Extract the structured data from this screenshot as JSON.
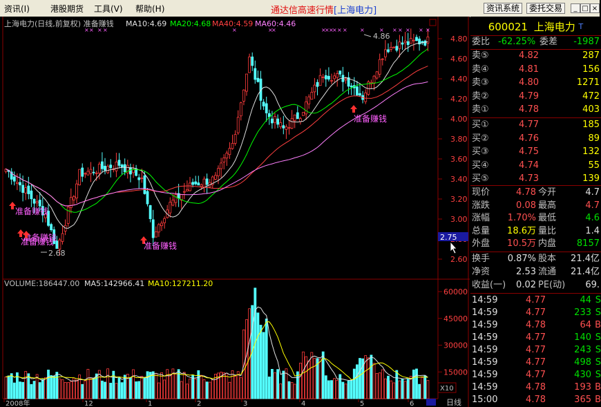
{
  "menu": [
    "资讯(I)",
    "港股期货",
    "工具(V)",
    "帮助(H)"
  ],
  "app_title": "通达信高速行情",
  "app_title_stock": "[上海电力]",
  "toolbar": {
    "info_system": "资讯系统",
    "trade": "委托交易"
  },
  "window_controls": [
    "_",
    "□",
    "×"
  ],
  "chart": {
    "header_title": "上海电力(日线,前复权) 准备赚钱",
    "ma_labels": [
      {
        "text": "MA10:4.69",
        "color": "#e0e0e0"
      },
      {
        "text": "MA20:4.68",
        "color": "#00ff00"
      },
      {
        "text": "MA40:4.59",
        "color": "#ff4040"
      },
      {
        "text": "MA60:4.46",
        "color": "#ff80ff"
      }
    ],
    "price_ticks": [
      "4.80",
      "4.60",
      "4.40",
      "4.20",
      "4.00",
      "3.80",
      "3.60",
      "3.40",
      "3.20",
      "3.00",
      "2.80",
      "2.60"
    ],
    "price_marker": "2.75",
    "high_label": "4.86",
    "low_label": "2.68",
    "signal_text": "准备赚钱",
    "volume_header": "VOLUME:186447.00",
    "vol_ma5": "MA5:142966.41",
    "vol_ma10": "MA10:127211.20",
    "volume_ticks": [
      "60000",
      "45000",
      "30000",
      "15000"
    ],
    "vol_unit": "X10",
    "date_labels": [
      "2008年",
      "12",
      "1",
      "2",
      "3",
      "4",
      "5",
      "6"
    ],
    "period": "日线"
  },
  "colors": {
    "up": "#ff3c3c",
    "down": "#54ffff",
    "ma10": "#e0e0e0",
    "ma20": "#00ff00",
    "ma40": "#ff4040",
    "ma60": "#ff80ff",
    "grid": "#8b0000"
  },
  "quote": {
    "code": "600021",
    "name": "上海电力",
    "ratio_label": "委比",
    "ratio": "-62.25%",
    "diff_label": "委差",
    "diff": "-1987",
    "asks": [
      {
        "label": "卖⑤",
        "price": "4.82",
        "vol": "287"
      },
      {
        "label": "卖④",
        "price": "4.81",
        "vol": "156"
      },
      {
        "label": "卖③",
        "price": "4.80",
        "vol": "1271"
      },
      {
        "label": "卖②",
        "price": "4.79",
        "vol": "472"
      },
      {
        "label": "卖①",
        "price": "4.78",
        "vol": "403"
      }
    ],
    "bids": [
      {
        "label": "买①",
        "price": "4.77",
        "vol": "185"
      },
      {
        "label": "买②",
        "price": "4.76",
        "vol": "89"
      },
      {
        "label": "买③",
        "price": "4.75",
        "vol": "132"
      },
      {
        "label": "买④",
        "price": "4.74",
        "vol": "55"
      },
      {
        "label": "买⑤",
        "price": "4.73",
        "vol": "139"
      }
    ],
    "stats": [
      {
        "l1": "现价",
        "v1": "4.78",
        "l2": "今开",
        "v2": "4.7"
      },
      {
        "l1": "涨跌",
        "v1": "0.08",
        "l2": "最高",
        "v2": "4.7"
      },
      {
        "l1": "涨幅",
        "v1": "1.70%",
        "l2": "最低",
        "v2": "4.6"
      },
      {
        "l1": "总量",
        "v1": "18.6万",
        "l2": "量比",
        "v2": "1.4"
      },
      {
        "l1": "外盘",
        "v1": "10.5万",
        "l2": "内盘",
        "v2": "8157"
      }
    ],
    "stats2": [
      {
        "l1": "换手",
        "v1": "0.87%",
        "l2": "股本",
        "v2": "21.4亿"
      },
      {
        "l1": "净资",
        "v1": "2.53",
        "l2": "流通",
        "v2": "21.4亿"
      },
      {
        "l1": "收益(一)",
        "v1": "0.02",
        "l2": "PE(动)",
        "v2": "69."
      }
    ],
    "ticks": [
      {
        "time": "14:59",
        "price": "4.77",
        "vol": "44",
        "dir": "S"
      },
      {
        "time": "14:59",
        "price": "4.77",
        "vol": "233",
        "dir": "S"
      },
      {
        "time": "14:59",
        "price": "4.78",
        "vol": "64",
        "dir": "B"
      },
      {
        "time": "14:59",
        "price": "4.77",
        "vol": "140",
        "dir": "S"
      },
      {
        "time": "14:59",
        "price": "4.77",
        "vol": "243",
        "dir": "S"
      },
      {
        "time": "14:59",
        "price": "4.77",
        "vol": "498",
        "dir": "S"
      },
      {
        "time": "14:59",
        "price": "4.77",
        "vol": "430",
        "dir": "S"
      },
      {
        "time": "14:59",
        "price": "4.78",
        "vol": "193",
        "dir": "B"
      },
      {
        "time": "15:00",
        "price": "4.78",
        "vol": "365",
        "dir": "B"
      }
    ]
  }
}
